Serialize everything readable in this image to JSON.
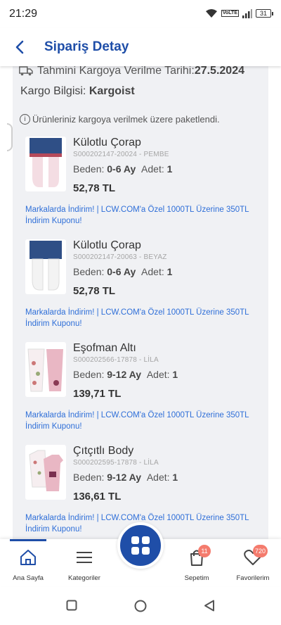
{
  "status_bar": {
    "time": "21:29",
    "battery": "31",
    "network": "VoLTE"
  },
  "header": {
    "title": "Sipariş Detay"
  },
  "shipping": {
    "date_label": "Tahmini Kargoya Verilme Tarihi:",
    "date_value": "27.5.2024",
    "cargo_label": "Kargo Bilgisi:",
    "cargo_value": "Kargoist",
    "info_text": "Ürünleriniz kargoya verilmek üzere paketlendi."
  },
  "items": [
    {
      "name": "Külotlu Çorap",
      "code": "S000202147-20024 - PEMBE",
      "size_label": "Beden:",
      "size": "0-6 Ay",
      "qty_label": "Adet:",
      "qty": "1",
      "price": "52,78 TL",
      "promo": "Markalarda İndirim! | LCW.COM'a Özel 1000TL Üzerine 350TL İndirim Kuponu!"
    },
    {
      "name": "Külotlu Çorap",
      "code": "S000202147-20063 - BEYAZ",
      "size_label": "Beden:",
      "size": "0-6 Ay",
      "qty_label": "Adet:",
      "qty": "1",
      "price": "52,78 TL",
      "promo": "Markalarda İndirim! | LCW.COM'a Özel 1000TL Üzerine 350TL İndirim Kuponu!"
    },
    {
      "name": "Eşofman Altı",
      "code": "S000202566-17878 - LİLA",
      "size_label": "Beden:",
      "size": "9-12 Ay",
      "qty_label": "Adet:",
      "qty": "1",
      "price": "139,71 TL",
      "promo": "Markalarda İndirim! | LCW.COM'a Özel 1000TL Üzerine 350TL İndirim Kuponu!"
    },
    {
      "name": "Çıtçıtlı Body",
      "code": "S000202595-17878 - LİLA",
      "size_label": "Beden:",
      "size": "9-12 Ay",
      "qty_label": "Adet:",
      "qty": "1",
      "price": "136,61 TL",
      "promo": "Markalarda İndirim! | LCW.COM'a Özel 1000TL Üzerine 350TL İndirim Kuponu!"
    }
  ],
  "bottom_nav": {
    "home": "Ana Sayfa",
    "categories": "Kategoriler",
    "cart": "Sepetim",
    "cart_badge": "11",
    "favorites": "Favorilerim",
    "favorites_badge": "720"
  },
  "colors": {
    "brand": "#1f4ea8",
    "promo": "#2f6fd8",
    "badge": "#f47b6d",
    "panel": "#f0f1f4"
  }
}
